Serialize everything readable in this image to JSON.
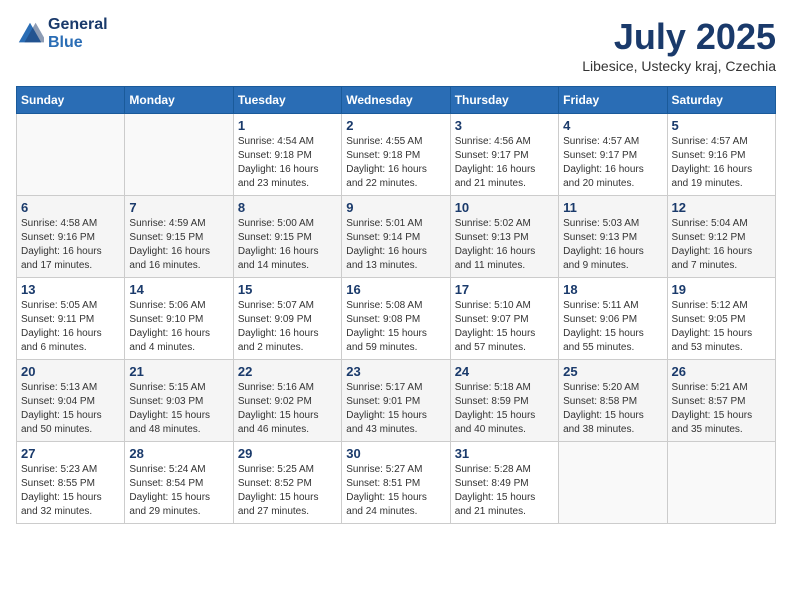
{
  "header": {
    "logo_line1": "General",
    "logo_line2": "Blue",
    "month": "July 2025",
    "location": "Libesice, Ustecky kraj, Czechia"
  },
  "days_of_week": [
    "Sunday",
    "Monday",
    "Tuesday",
    "Wednesday",
    "Thursday",
    "Friday",
    "Saturday"
  ],
  "weeks": [
    [
      {
        "day": "",
        "info": ""
      },
      {
        "day": "",
        "info": ""
      },
      {
        "day": "1",
        "info": "Sunrise: 4:54 AM\nSunset: 9:18 PM\nDaylight: 16 hours\nand 23 minutes."
      },
      {
        "day": "2",
        "info": "Sunrise: 4:55 AM\nSunset: 9:18 PM\nDaylight: 16 hours\nand 22 minutes."
      },
      {
        "day": "3",
        "info": "Sunrise: 4:56 AM\nSunset: 9:17 PM\nDaylight: 16 hours\nand 21 minutes."
      },
      {
        "day": "4",
        "info": "Sunrise: 4:57 AM\nSunset: 9:17 PM\nDaylight: 16 hours\nand 20 minutes."
      },
      {
        "day": "5",
        "info": "Sunrise: 4:57 AM\nSunset: 9:16 PM\nDaylight: 16 hours\nand 19 minutes."
      }
    ],
    [
      {
        "day": "6",
        "info": "Sunrise: 4:58 AM\nSunset: 9:16 PM\nDaylight: 16 hours\nand 17 minutes."
      },
      {
        "day": "7",
        "info": "Sunrise: 4:59 AM\nSunset: 9:15 PM\nDaylight: 16 hours\nand 16 minutes."
      },
      {
        "day": "8",
        "info": "Sunrise: 5:00 AM\nSunset: 9:15 PM\nDaylight: 16 hours\nand 14 minutes."
      },
      {
        "day": "9",
        "info": "Sunrise: 5:01 AM\nSunset: 9:14 PM\nDaylight: 16 hours\nand 13 minutes."
      },
      {
        "day": "10",
        "info": "Sunrise: 5:02 AM\nSunset: 9:13 PM\nDaylight: 16 hours\nand 11 minutes."
      },
      {
        "day": "11",
        "info": "Sunrise: 5:03 AM\nSunset: 9:13 PM\nDaylight: 16 hours\nand 9 minutes."
      },
      {
        "day": "12",
        "info": "Sunrise: 5:04 AM\nSunset: 9:12 PM\nDaylight: 16 hours\nand 7 minutes."
      }
    ],
    [
      {
        "day": "13",
        "info": "Sunrise: 5:05 AM\nSunset: 9:11 PM\nDaylight: 16 hours\nand 6 minutes."
      },
      {
        "day": "14",
        "info": "Sunrise: 5:06 AM\nSunset: 9:10 PM\nDaylight: 16 hours\nand 4 minutes."
      },
      {
        "day": "15",
        "info": "Sunrise: 5:07 AM\nSunset: 9:09 PM\nDaylight: 16 hours\nand 2 minutes."
      },
      {
        "day": "16",
        "info": "Sunrise: 5:08 AM\nSunset: 9:08 PM\nDaylight: 15 hours\nand 59 minutes."
      },
      {
        "day": "17",
        "info": "Sunrise: 5:10 AM\nSunset: 9:07 PM\nDaylight: 15 hours\nand 57 minutes."
      },
      {
        "day": "18",
        "info": "Sunrise: 5:11 AM\nSunset: 9:06 PM\nDaylight: 15 hours\nand 55 minutes."
      },
      {
        "day": "19",
        "info": "Sunrise: 5:12 AM\nSunset: 9:05 PM\nDaylight: 15 hours\nand 53 minutes."
      }
    ],
    [
      {
        "day": "20",
        "info": "Sunrise: 5:13 AM\nSunset: 9:04 PM\nDaylight: 15 hours\nand 50 minutes."
      },
      {
        "day": "21",
        "info": "Sunrise: 5:15 AM\nSunset: 9:03 PM\nDaylight: 15 hours\nand 48 minutes."
      },
      {
        "day": "22",
        "info": "Sunrise: 5:16 AM\nSunset: 9:02 PM\nDaylight: 15 hours\nand 46 minutes."
      },
      {
        "day": "23",
        "info": "Sunrise: 5:17 AM\nSunset: 9:01 PM\nDaylight: 15 hours\nand 43 minutes."
      },
      {
        "day": "24",
        "info": "Sunrise: 5:18 AM\nSunset: 8:59 PM\nDaylight: 15 hours\nand 40 minutes."
      },
      {
        "day": "25",
        "info": "Sunrise: 5:20 AM\nSunset: 8:58 PM\nDaylight: 15 hours\nand 38 minutes."
      },
      {
        "day": "26",
        "info": "Sunrise: 5:21 AM\nSunset: 8:57 PM\nDaylight: 15 hours\nand 35 minutes."
      }
    ],
    [
      {
        "day": "27",
        "info": "Sunrise: 5:23 AM\nSunset: 8:55 PM\nDaylight: 15 hours\nand 32 minutes."
      },
      {
        "day": "28",
        "info": "Sunrise: 5:24 AM\nSunset: 8:54 PM\nDaylight: 15 hours\nand 29 minutes."
      },
      {
        "day": "29",
        "info": "Sunrise: 5:25 AM\nSunset: 8:52 PM\nDaylight: 15 hours\nand 27 minutes."
      },
      {
        "day": "30",
        "info": "Sunrise: 5:27 AM\nSunset: 8:51 PM\nDaylight: 15 hours\nand 24 minutes."
      },
      {
        "day": "31",
        "info": "Sunrise: 5:28 AM\nSunset: 8:49 PM\nDaylight: 15 hours\nand 21 minutes."
      },
      {
        "day": "",
        "info": ""
      },
      {
        "day": "",
        "info": ""
      }
    ]
  ]
}
